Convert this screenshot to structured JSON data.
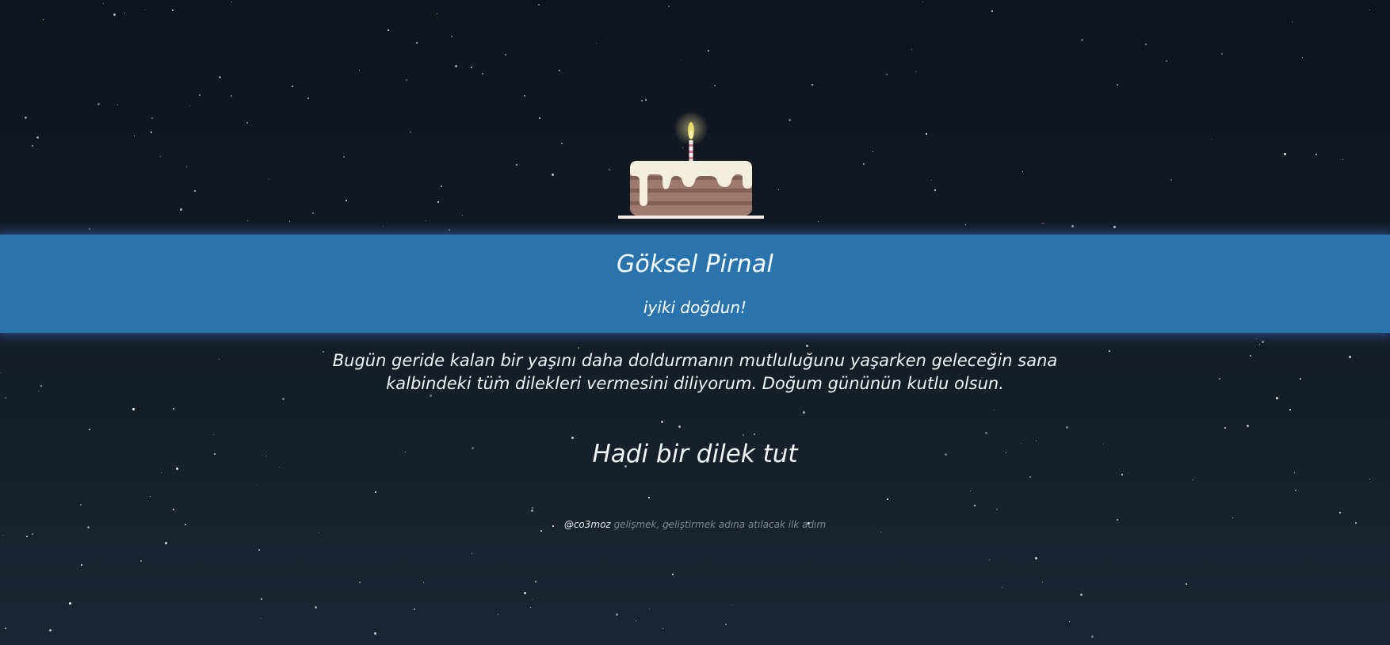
{
  "card": {
    "name": "Göksel Pirnal",
    "greeting": "iyiki doğdun!",
    "message_line1": "Bugün geride kalan bir yaşını daha doldurmanın mutluluğunu yaşarken geleceğin sana",
    "message_line2": "kalbindeki tüm dilekleri vermesini diliyorum. Doğum gününün kutlu olsun.",
    "wish_prompt": "Hadi bir dilek tut"
  },
  "footer": {
    "handle": "@co3moz",
    "text": "gelişmek, geliştirmek adına atılacak ilk adım"
  },
  "icons": {
    "cake": "birthday-cake-icon",
    "candle": "candle-icon"
  },
  "colors": {
    "background": "#131a24",
    "banner": "#2a74ae",
    "cake_body": "#9e7a6e",
    "frosting": "#f3efdf",
    "flame": "#e9e07a"
  }
}
